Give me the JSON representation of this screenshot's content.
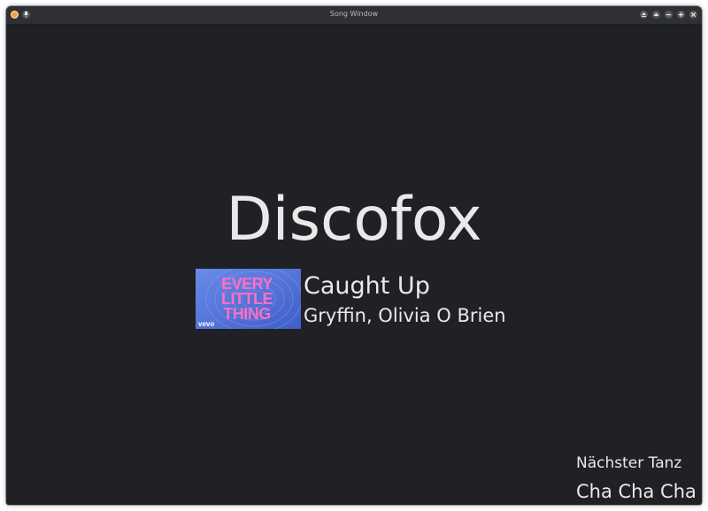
{
  "window": {
    "title": "Song Window"
  },
  "titlebar": {
    "left_icons": [
      "app-icon",
      "pin-icon"
    ],
    "right_buttons": [
      "keep-above-icon",
      "shade-icon",
      "minimize-icon",
      "maximize-icon",
      "close-icon"
    ]
  },
  "current": {
    "dance": "Discofox",
    "song_title": "Caught Up",
    "artist": "Gryffin, Olivia O Brien"
  },
  "cover": {
    "lines": [
      "EVERY",
      "LITTLE",
      "THING"
    ],
    "brand": "vevo",
    "colors": {
      "background": "#4f6fd6",
      "text": "#ff6fc4"
    }
  },
  "next": {
    "label": "Nächster Tanz",
    "dance": "Cha Cha Cha"
  },
  "colors": {
    "background": "#202124",
    "text": "#e9e9e9",
    "titlebar": "#2e3033"
  }
}
